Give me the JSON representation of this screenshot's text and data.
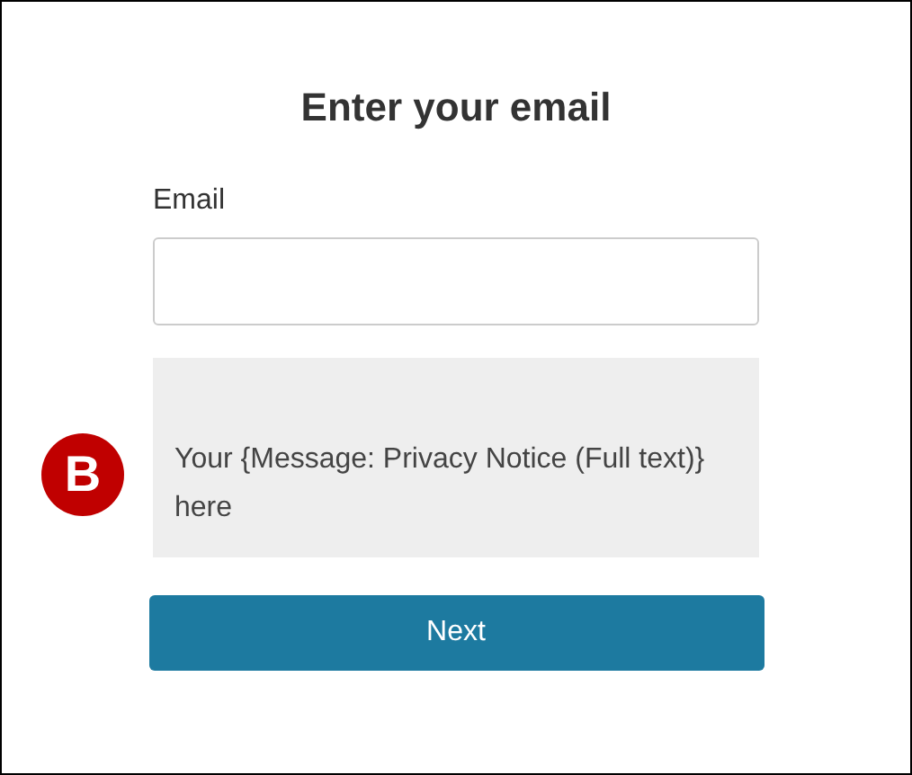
{
  "title": "Enter your email",
  "email_field": {
    "label": "Email"
  },
  "notice": {
    "text": "Your {Message: Privacy Notice (Full text)} here"
  },
  "badge": {
    "text": "B"
  },
  "buttons": [
    {
      "label": "Next"
    }
  ]
}
